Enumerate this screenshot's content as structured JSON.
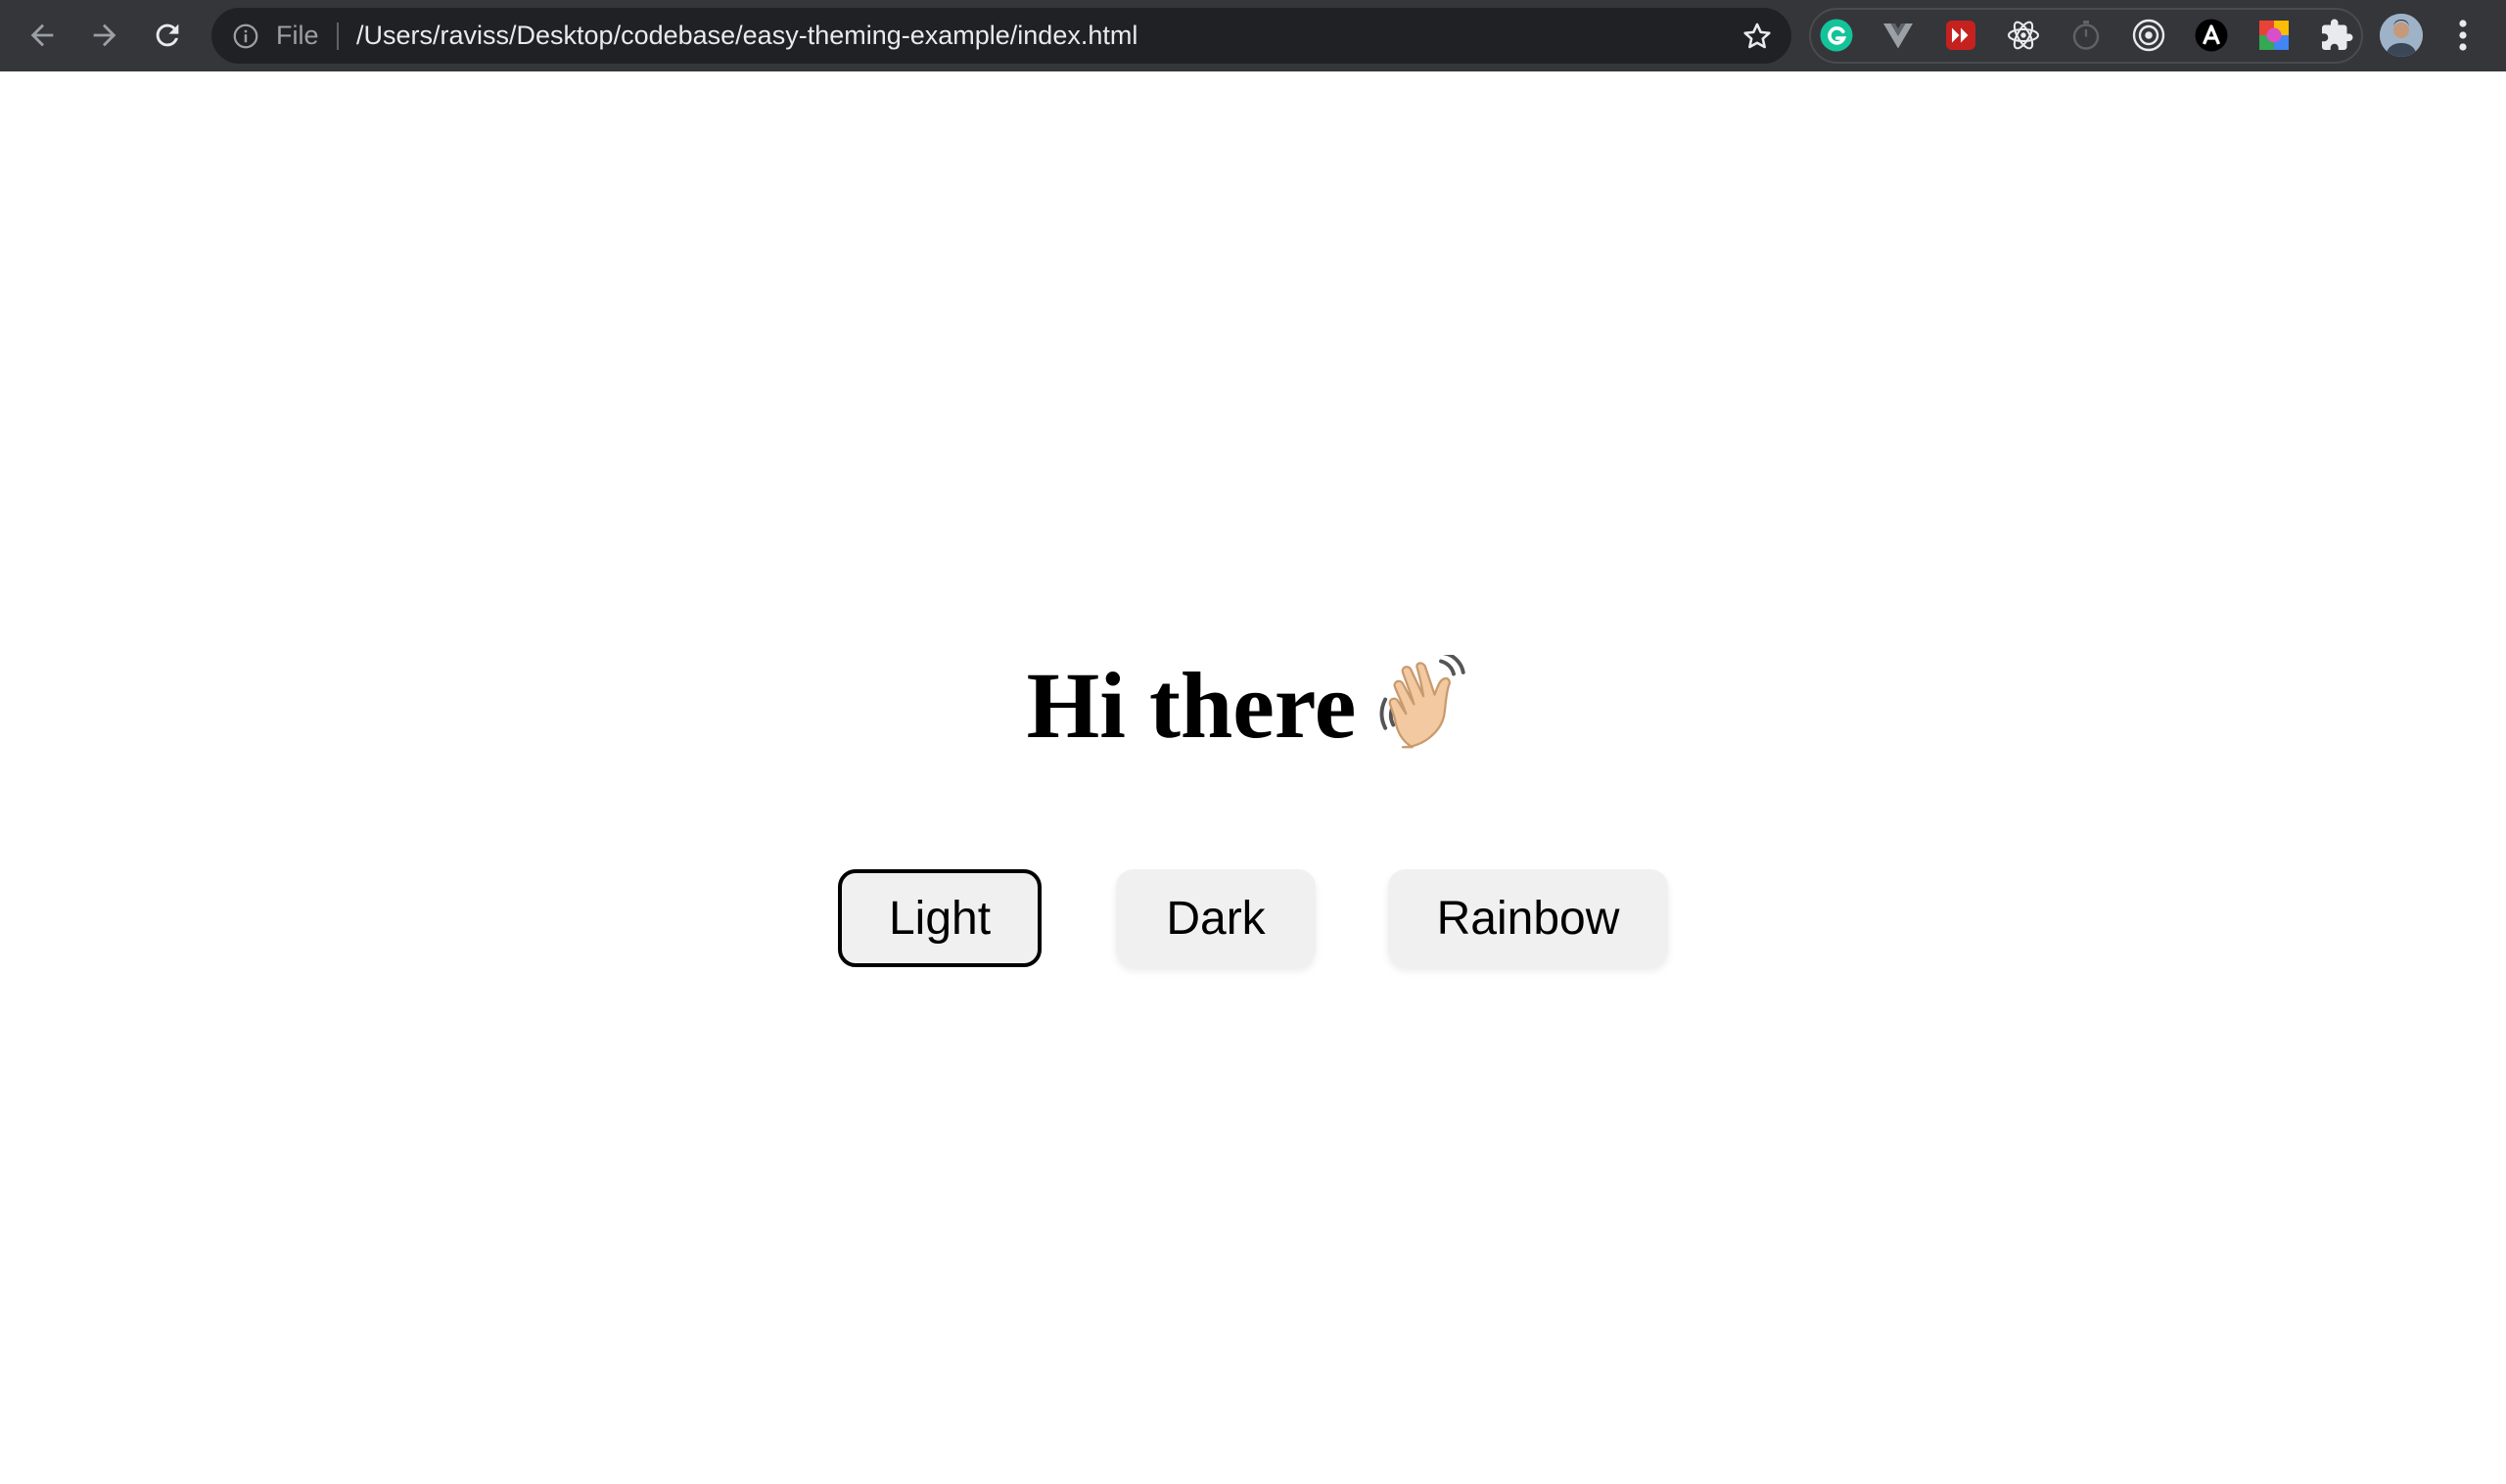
{
  "browser": {
    "scheme_label": "File",
    "url": "/Users/raviss/Desktop/codebase/easy-theming-example/index.html",
    "extensions": [
      "grammarly-icon",
      "vue-devtools-icon",
      "video-speed-icon",
      "react-devtools-icon",
      "timer-icon",
      "target-icon",
      "a-extension-icon",
      "color-picker-icon",
      "puzzle-extensions-icon"
    ],
    "colors": {
      "toolbar": "#35363a",
      "omnibox": "#202124",
      "url_text": "#e8eaed",
      "muted": "#9aa0a6"
    }
  },
  "page": {
    "heading": "Hi there",
    "wave_icon": "waving-hand-emoji",
    "buttons": {
      "light": "Light",
      "dark": "Dark",
      "rainbow": "Rainbow"
    },
    "selected_theme": "Light"
  }
}
